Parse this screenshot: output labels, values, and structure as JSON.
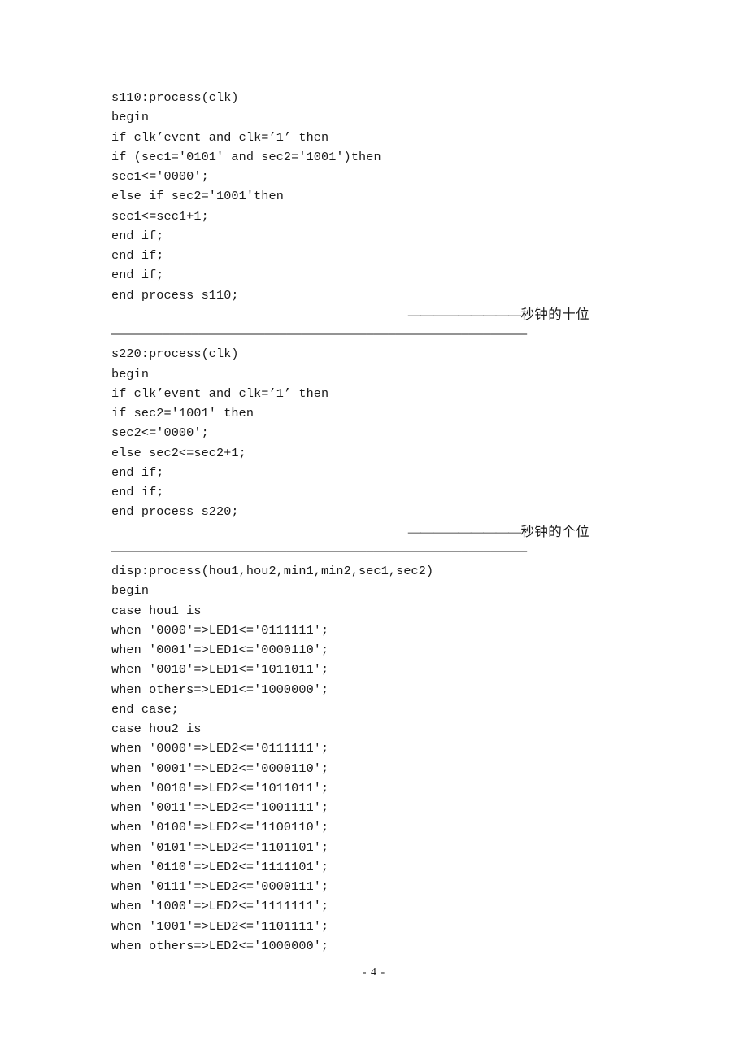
{
  "document": {
    "page_number": "- 4 -",
    "language": "VHDL"
  },
  "body": {
    "blocks": [
      {
        "type": "code",
        "name": "process-s110",
        "lines": [
          "s110:process(clk)",
          "begin",
          "if clk’event and clk=’1’ then",
          "if (sec1=′0101′ and sec2=′1001′)then",
          "sec1<=′0000′;",
          "else if sec2=′1001′then",
          "sec1<=sec1+1;",
          "end if;",
          "end if;",
          "end if;",
          "end process s110;"
        ]
      },
      {
        "type": "annotation",
        "name": "annotation-seconds-tens",
        "dashes": "—————————",
        "text": "秒钟的十位"
      },
      {
        "type": "separator",
        "name": "separator-rule-1",
        "char": "—",
        "count": 57
      },
      {
        "type": "code",
        "name": "process-s220",
        "lines": [
          "s220:process(clk)",
          "begin",
          "if clk’event and clk=’1’ then",
          "if sec2=′1001′ then",
          "sec2<=′0000′;",
          "else sec2<=sec2+1;",
          "end if;",
          "end if;",
          "end process s220;"
        ]
      },
      {
        "type": "annotation",
        "name": "annotation-seconds-units",
        "dashes": "—————————",
        "text": "秒钟的个位"
      },
      {
        "type": "separator",
        "name": "separator-rule-2",
        "char": "—",
        "count": 57
      },
      {
        "type": "code",
        "name": "process-disp",
        "lines": [
          "disp:process(hou1,hou2,min1,min2,sec1,sec2)",
          "begin",
          "case hou1 is",
          "when ′0000′=>LED1<=′0111111′;",
          "when ′0001′=>LED1<=′0000110′;",
          "when ′0010′=>LED1<=′1011011′;",
          "when others=>LED1<=′1000000′;",
          "end case;",
          "case hou2 is",
          "when ′0000′=>LED2<=′0111111′;",
          "when ′0001′=>LED2<=′0000110′;",
          "when ′0010′=>LED2<=′1011011′;",
          "when ′0011′=>LED2<=′1001111′;",
          "when ′0100′=>LED2<=′1100110′;",
          "when ′0101′=>LED2<=′1101101′;",
          "when ′0110′=>LED2<=′1111101′;",
          "when ′0111′=>LED2<=′0000111′;",
          "when ′1000′=>LED2<=′1111111′;",
          "when ′1001′=>LED2<=′1101111′;",
          "when others=>LED2<=′1000000′;"
        ]
      }
    ]
  }
}
